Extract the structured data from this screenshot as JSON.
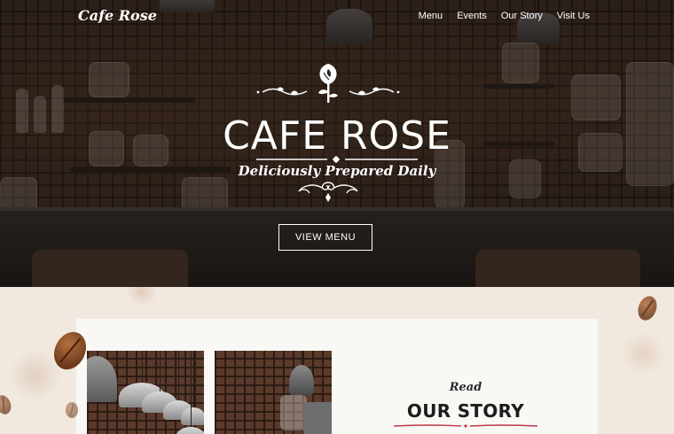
{
  "nav": {
    "brand": "Cafe Rose",
    "links": [
      {
        "label": "Menu"
      },
      {
        "label": "Events"
      },
      {
        "label": "Our Story"
      },
      {
        "label": "Visit Us"
      }
    ]
  },
  "hero": {
    "title": "CAFE ROSE",
    "tagline": "Deliciously Prepared Daily",
    "cta_label": "VIEW MENU",
    "icons": [
      "rose-icon",
      "flourish-left-icon",
      "flourish-right-icon",
      "scroll-ornament-icon"
    ]
  },
  "story": {
    "pre_title": "Read",
    "title": "OUR STORY"
  },
  "colors": {
    "hero_overlay": "#2d2622",
    "page_background": "#f1e9df",
    "card_background": "#faf8f5",
    "accent_rule": "#c0394b",
    "text_dark": "#1d1d1d",
    "text_light": "#ffffff"
  }
}
